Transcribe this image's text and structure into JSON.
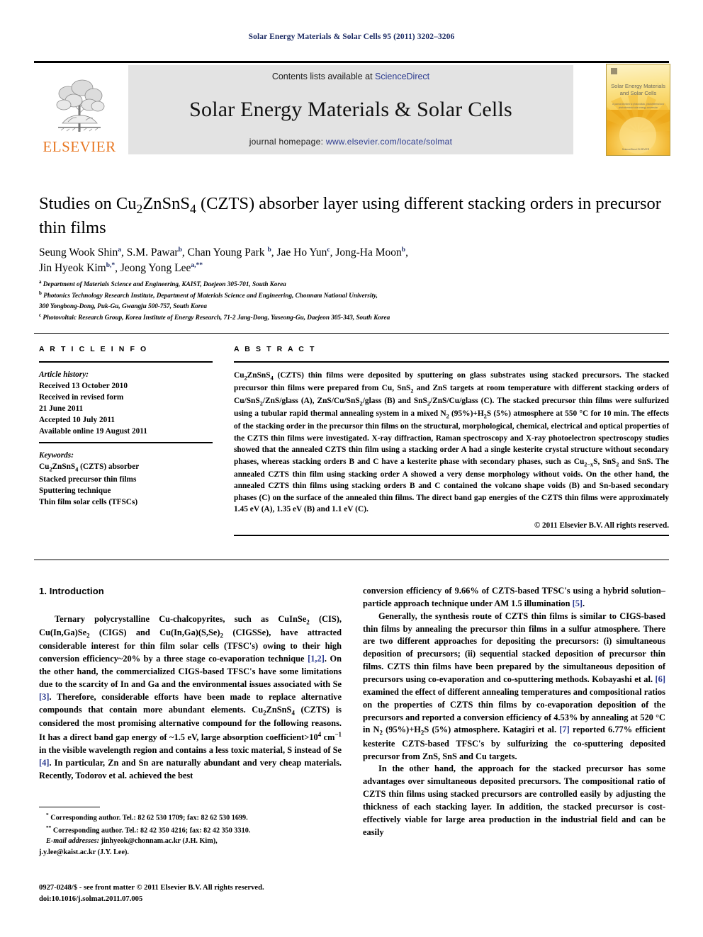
{
  "running_head": "Solar Energy Materials & Solar Cells 95 (2011) 3202–3206",
  "masthead": {
    "publisher_name": "ELSEVIER",
    "contents_prefix": "Contents lists available at ",
    "sciencedirect": "ScienceDirect",
    "journal_title": "Solar Energy Materials & Solar Cells",
    "homepage_prefix": "journal homepage: ",
    "homepage_url": "www.elsevier.com/locate/solmat",
    "cover_title": "Solar Energy Materials and Solar Cells",
    "cover_subtitle": "A journal devoted to photovoltaic, photothermal and photochemical solar energy conversion",
    "cover_footer": "ScienceDirect  ELSEVIER"
  },
  "article": {
    "title_line1": "Studies on Cu2ZnSnS4 (CZTS) absorber layer using different stacking",
    "title_line2": "orders in precursor thin films",
    "authors": [
      {
        "name": "Seung Wook Shin",
        "marks": "a"
      },
      {
        "name": "S.M. Pawar",
        "marks": "b"
      },
      {
        "name": "Chan Young Park",
        "marks": "b"
      },
      {
        "name": "Jae Ho Yun",
        "marks": "c"
      },
      {
        "name": "Jong-Ha Moon",
        "marks": "b"
      },
      {
        "name": "Jin Hyeok Kim",
        "marks": "b,*"
      },
      {
        "name": "Jeong Yong Lee",
        "marks": "a,**"
      }
    ],
    "affiliations": [
      {
        "mark": "a",
        "text": "Department of Materials Science and Engineering, KAIST, Daejeon 305-701, South Korea"
      },
      {
        "mark": "b",
        "text": "Photonics Technology Research Institute, Department of Materials Science and Engineering, Chonnam National University,"
      },
      {
        "mark": "",
        "text": "300 Yongbong-Dong, Puk-Gu, Gwangju 500-757, South Korea"
      },
      {
        "mark": "c",
        "text": "Photovoltaic Research Group, Korea Institute of Energy Research, 71-2 Jang-Dong, Yuseong-Gu, Daejeon 305-343, South Korea"
      }
    ]
  },
  "article_info": {
    "heading": "A R T I C L E   I N F O",
    "history_label": "Article history:",
    "history": [
      "Received 13 October 2010",
      "Received in revised form",
      "21 June 2011",
      "Accepted 10 July 2011",
      "Available online 19 August 2011"
    ],
    "keywords_label": "Keywords:",
    "keywords": [
      "Cu2ZnSnS4 (CZTS) absorber",
      "Stacked precursor thin films",
      "Sputtering technique",
      "Thin film solar cells (TFSCs)"
    ]
  },
  "abstract": {
    "heading": "A B S T R A C T",
    "copyright": "© 2011 Elsevier B.V. All rights reserved."
  },
  "body": {
    "section1_heading": "1.  Introduction",
    "left_p1_a": "Ternary polycrystalline Cu-chalcopyrites, such as CuInSe",
    "left_p1_b": "(CIS), Cu(In,Ga)Se",
    "left_p1_c": " (CIGS) and Cu(In,Ga)(S,Se)",
    "left_p1_d": " (CIGSSe), have attracted considerable interest for thin film solar cells (TFSC's) owing to their high conversion efficiency~20% by a three stage co-evaporation technique ",
    "ref12": "[1,2]",
    "left_p1_e": ". On the other hand, the commercialized CIGS-based TFSC's have some limitations due to the scarcity of In and Ga and the environmental issues associated with Se ",
    "ref3": "[3]",
    "left_p1_f": ". Therefore, considerable efforts have been made to replace alternative compounds that contain more abundant elements. Cu",
    "left_p1_g": "ZnSnS",
    "left_p1_h": " (CZTS) is considered the most promising alternative compound for the following reasons. It has a direct band gap energy of ~1.5 eV, large absorption coefficient",
    "left_p1_i": " in the visible wavelength region and contains a less toxic material, S instead of Se ",
    "ref4": "[4]",
    "left_p1_j": ". In particular, Zn and Sn are naturally abundant and very cheap materials. Recently, Todorov et al. achieved the best",
    "right_p1_a": "conversion efficiency of 9.66% of CZTS-based TFSC's using a hybrid solution–particle approach technique under AM 1.5 illumination ",
    "ref5": "[5]",
    "right_p1_b": ".",
    "right_p2_a": "Generally, the synthesis route of CZTS thin films is similar to CIGS-based thin films by annealing the precursor thin films in a sulfur atmosphere. There are two different approaches for depositing the precursors: (i) simultaneous deposition of precursors; (ii) sequential stacked deposition of precursor thin films. CZTS thin films have been prepared by the simultaneous deposition of precursors using co-evaporation and co-sputtering methods. Kobayashi et al. ",
    "ref6": "[6]",
    "right_p2_b": " examined the effect of different annealing temperatures and compositional ratios on the properties of CZTS thin films by co-evaporation deposition of the precursors and reported a conversion efficiency of 4.53% by annealing at 520 °C in N",
    "right_p2_c": " (95%)+H",
    "right_p2_d": "S (5%) atmosphere. Katagiri et al. ",
    "ref7": "[7]",
    "right_p2_e": " reported 6.77% efficient kesterite CZTS-based TFSC's by sulfurizing the co-sputtering deposited precursor from ZnS, SnS and Cu targets.",
    "right_p3": "In the other hand, the approach for the stacked precursor has some advantages over simultaneous deposited precursors. The compositional ratio of CZTS thin films using stacked precursors are controlled easily by adjusting the thickness of each stacking layer. In addition, the stacked precursor is cost-effectively viable for large area production in the industrial field and can be easily"
  },
  "footnotes": {
    "line1": "Corresponding author. Tel.: 82 62 530 1709; fax: 82 62 530 1699.",
    "line2": "Corresponding author. Tel.: 82 42 350 4216; fax: 82 42 350 3310.",
    "email_label": "E-mail addresses:",
    "email1": " jinhyeok@chonnam.ac.kr (J.H. Kim),",
    "email2": "j.y.lee@kaist.ac.kr (J.Y. Lee)."
  },
  "imprint": {
    "line1": "0927-0248/$ - see front matter © 2011 Elsevier B.V. All rights reserved.",
    "line2": "doi:10.1016/j.solmat.2011.07.005"
  }
}
